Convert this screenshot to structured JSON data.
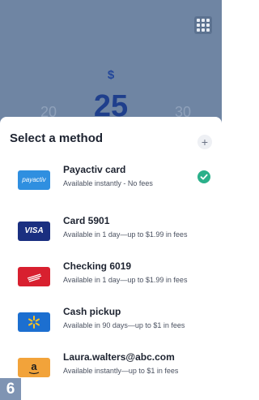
{
  "colors": {
    "backdrop": "#6f85a3",
    "accent": "#1f3f8c",
    "success": "#2bb08a"
  },
  "amount": {
    "currency": "$",
    "selected": "25",
    "previous": "20",
    "next": "30"
  },
  "header": {
    "menu_icon": "grid-icon"
  },
  "sheet": {
    "title": "Select a method",
    "add_icon": "+",
    "methods": [
      {
        "logo": "payactiv",
        "name": "Payactiv card",
        "subtitle": "Available instantly - No fees",
        "selected": true
      },
      {
        "logo": "VISA",
        "name": "Card 5901",
        "subtitle": "Available in 1 day—up to $1.99 in fees",
        "selected": false
      },
      {
        "logo": "bank-of-america-icon",
        "name": "Checking 6019",
        "subtitle": "Available in 1 day—up to $1.99 in fees",
        "selected": false
      },
      {
        "logo": "walmart-spark-icon",
        "name": "Cash pickup",
        "subtitle": "Available in 90 days—up to $1 in fees",
        "selected": false
      },
      {
        "logo": "a",
        "name": "Laura.walters@abc.com",
        "subtitle": "Available instantly—up to $1 in fees",
        "selected": false
      }
    ]
  },
  "step_badge": "6"
}
